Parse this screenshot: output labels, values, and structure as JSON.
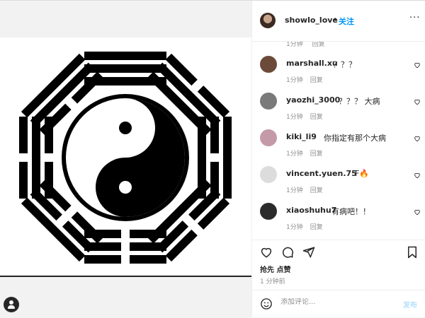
{
  "post": {
    "owner": "showlo_love",
    "dot": "•",
    "follow_label": "关注",
    "more_label": "···"
  },
  "comments_partial_meta": {
    "time": "1分钟",
    "reply": "回复"
  },
  "comments": [
    {
      "user": "marshall.xu",
      "text": "？？？",
      "time": "1分钟",
      "reply": "回复",
      "avatar_color": "#6b4a3a"
    },
    {
      "user": "yaozhi_3000",
      "text": "？？？ 大病",
      "time": "1分钟",
      "reply": "回复",
      "avatar_color": "#7a7a7a"
    },
    {
      "user": "kiki_li9",
      "text": "你指定有那个大病",
      "time": "1分钟",
      "reply": "回复",
      "avatar_color": "#c49aa8"
    },
    {
      "user": "vincent.yuen.75",
      "text": "F🔥",
      "time": "1分钟",
      "reply": "回复",
      "avatar_color": "#dcdcdc"
    },
    {
      "user": "xiaoshuhu7",
      "text": "有病吧！！",
      "time": "1分钟",
      "reply": "回复",
      "avatar_color": "#2b2b2b"
    }
  ],
  "stats": {
    "likes": "抢先 点赞",
    "time": "1 分钟前"
  },
  "composer": {
    "placeholder": "添加评论...",
    "post_label": "发布"
  },
  "icons": {
    "like": "heart-icon",
    "comment": "comment-icon",
    "share": "share-icon",
    "save": "bookmark-icon",
    "emoji": "emoji-icon",
    "tag": "user-tag-icon"
  },
  "colors": {
    "accent": "#0095f6",
    "post_disabled": "#b2dffc",
    "muted": "#8e8e8e"
  }
}
